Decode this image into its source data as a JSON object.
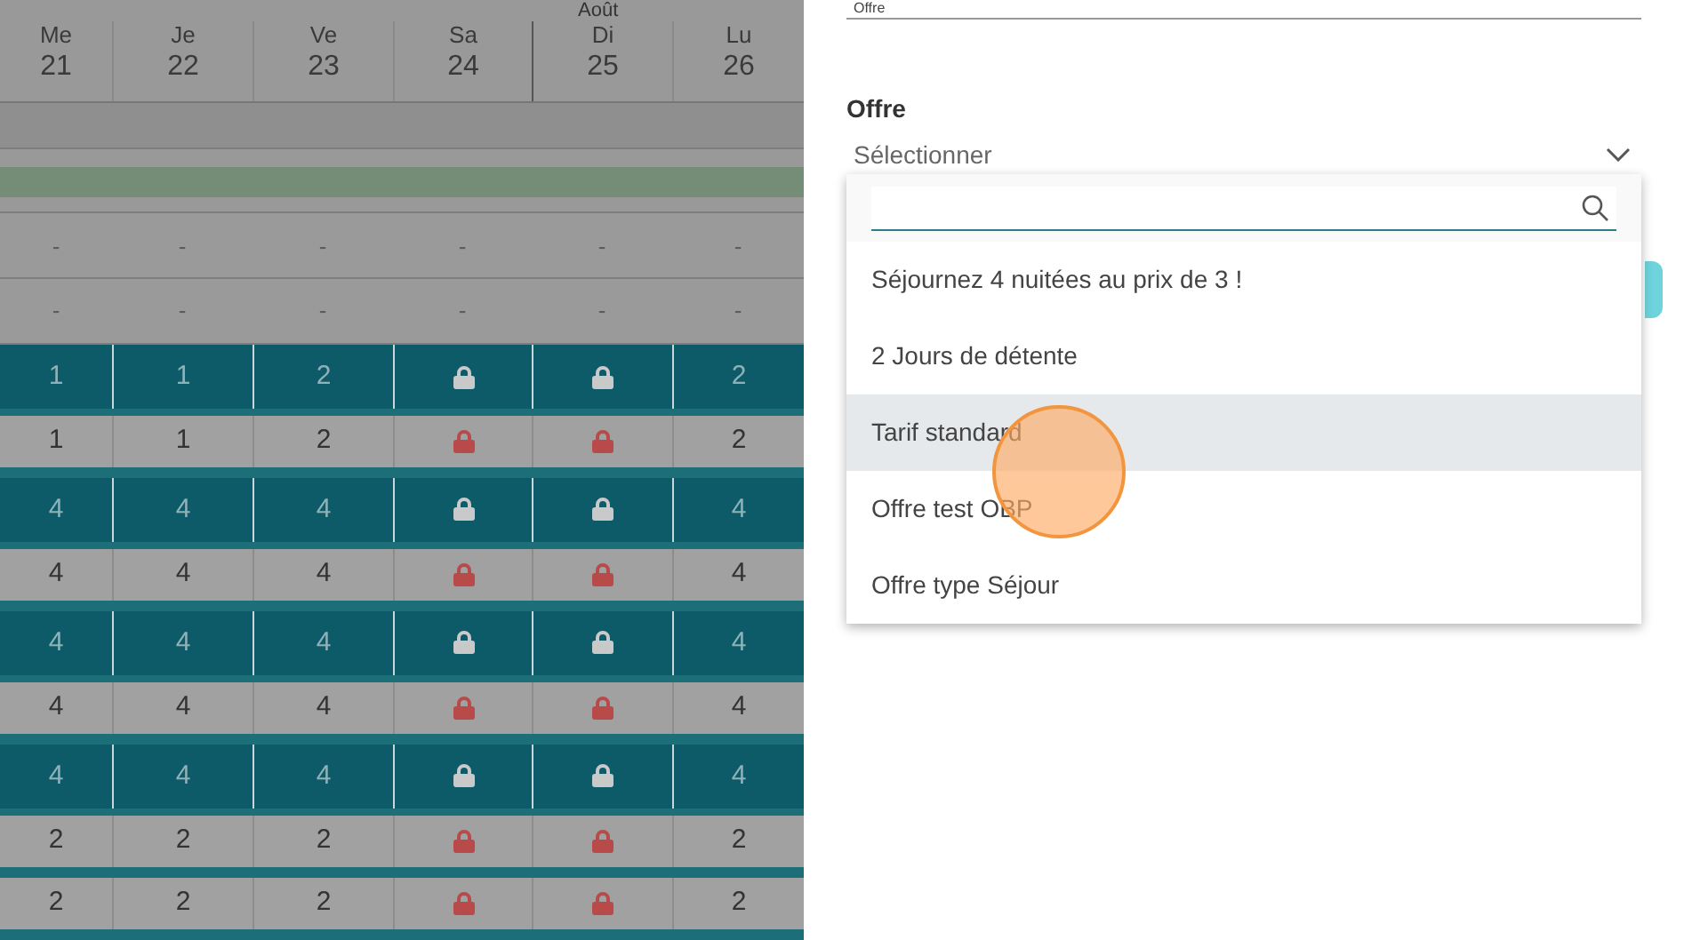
{
  "calendar": {
    "month": "Août",
    "days": [
      {
        "day": "Me",
        "date": "21"
      },
      {
        "day": "Je",
        "date": "22"
      },
      {
        "day": "Ve",
        "date": "23"
      },
      {
        "day": "Sa",
        "date": "24"
      },
      {
        "day": "Di",
        "date": "25"
      },
      {
        "day": "Lu",
        "date": "26"
      }
    ],
    "rows": [
      {
        "kind": "empty",
        "cells": [
          "-",
          "-",
          "-",
          "-",
          "-",
          "-"
        ]
      },
      {
        "kind": "empty",
        "cells": [
          "-",
          "-",
          "-",
          "-",
          "-",
          "-"
        ]
      },
      {
        "kind": "rate",
        "cells": [
          {
            "text": "1"
          },
          {
            "text": "1"
          },
          {
            "text": "2"
          },
          {
            "locked": true
          },
          {
            "locked": true
          },
          {
            "text": "2"
          }
        ]
      },
      {
        "kind": "stock",
        "cells": [
          {
            "text": "1"
          },
          {
            "text": "1"
          },
          {
            "text": "2"
          },
          {
            "locked": true
          },
          {
            "locked": true
          },
          {
            "text": "2"
          }
        ]
      },
      {
        "kind": "rate",
        "cells": [
          {
            "text": "4"
          },
          {
            "text": "4"
          },
          {
            "text": "4"
          },
          {
            "locked": true
          },
          {
            "locked": true
          },
          {
            "text": "4"
          }
        ]
      },
      {
        "kind": "stock",
        "cells": [
          {
            "text": "4"
          },
          {
            "text": "4"
          },
          {
            "text": "4"
          },
          {
            "locked": true
          },
          {
            "locked": true
          },
          {
            "text": "4"
          }
        ]
      },
      {
        "kind": "rate",
        "cells": [
          {
            "text": "4"
          },
          {
            "text": "4"
          },
          {
            "text": "4"
          },
          {
            "locked": true
          },
          {
            "locked": true
          },
          {
            "text": "4"
          }
        ]
      },
      {
        "kind": "stock",
        "cells": [
          {
            "text": "4"
          },
          {
            "text": "4"
          },
          {
            "text": "4"
          },
          {
            "locked": true
          },
          {
            "locked": true
          },
          {
            "text": "4"
          }
        ]
      },
      {
        "kind": "rate",
        "cells": [
          {
            "text": "4"
          },
          {
            "text": "4"
          },
          {
            "text": "4"
          },
          {
            "locked": true
          },
          {
            "locked": true
          },
          {
            "text": "4"
          }
        ]
      },
      {
        "kind": "stock",
        "cells": [
          {
            "text": "2"
          },
          {
            "text": "2"
          },
          {
            "text": "2"
          },
          {
            "locked": true
          },
          {
            "locked": true
          },
          {
            "text": "2"
          }
        ]
      },
      {
        "kind": "stock",
        "cells": [
          {
            "text": "2"
          },
          {
            "text": "2"
          },
          {
            "text": "2"
          },
          {
            "locked": true
          },
          {
            "locked": true
          },
          {
            "text": "2"
          }
        ]
      }
    ]
  },
  "form": {
    "previous_field_value": "Offre",
    "offer_field": {
      "label": "Offre",
      "placeholder": "Sélectionner"
    },
    "dropdown": {
      "items": [
        {
          "label": "Séjournez 4 nuitées au prix de 3 !",
          "selected": false
        },
        {
          "label": "2 Jours de détente",
          "selected": false
        },
        {
          "label": "Tarif standard",
          "selected": true
        },
        {
          "label": "Offre test OBP",
          "selected": false
        },
        {
          "label": "Offre type Séjour",
          "selected": false
        }
      ]
    }
  }
}
